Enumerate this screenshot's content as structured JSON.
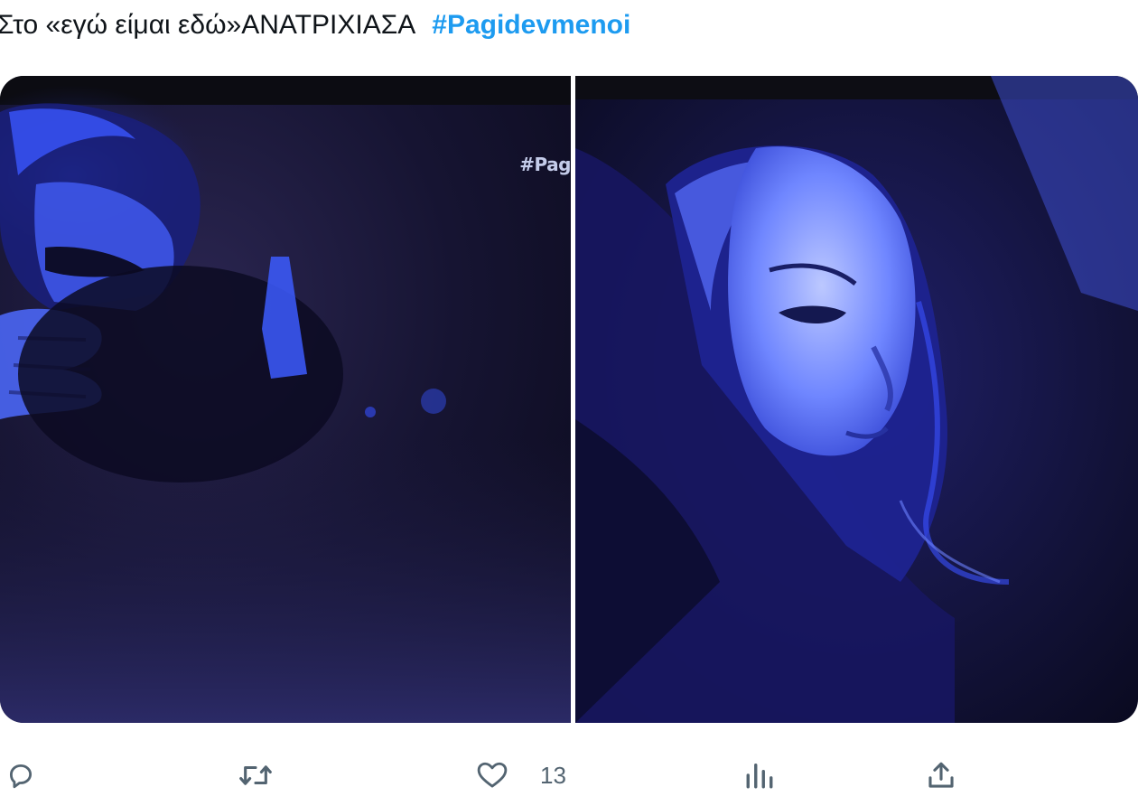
{
  "tweet": {
    "text": "Στο «εγώ είμαι εδώ»ΑΝΑΤΡΙΧΙΑΣΑ",
    "hashtag": "#Pagidevmenoi"
  },
  "media": {
    "left_photo": {
      "description_icon": "photo-tv-screen-man-covering-face",
      "watermark": "#Pag"
    },
    "right_photo": {
      "description_icon": "photo-tv-screen-woman-face-blue-light"
    }
  },
  "actions": {
    "reply": {
      "icon": "reply-icon"
    },
    "retweet": {
      "icon": "retweet-icon"
    },
    "like": {
      "icon": "heart-icon",
      "count": "13"
    },
    "views": {
      "icon": "analytics-icon"
    },
    "share": {
      "icon": "share-icon"
    }
  },
  "colors": {
    "text": "#0f1419",
    "hashtag": "#1d9bf0",
    "action_icon": "#536471"
  }
}
